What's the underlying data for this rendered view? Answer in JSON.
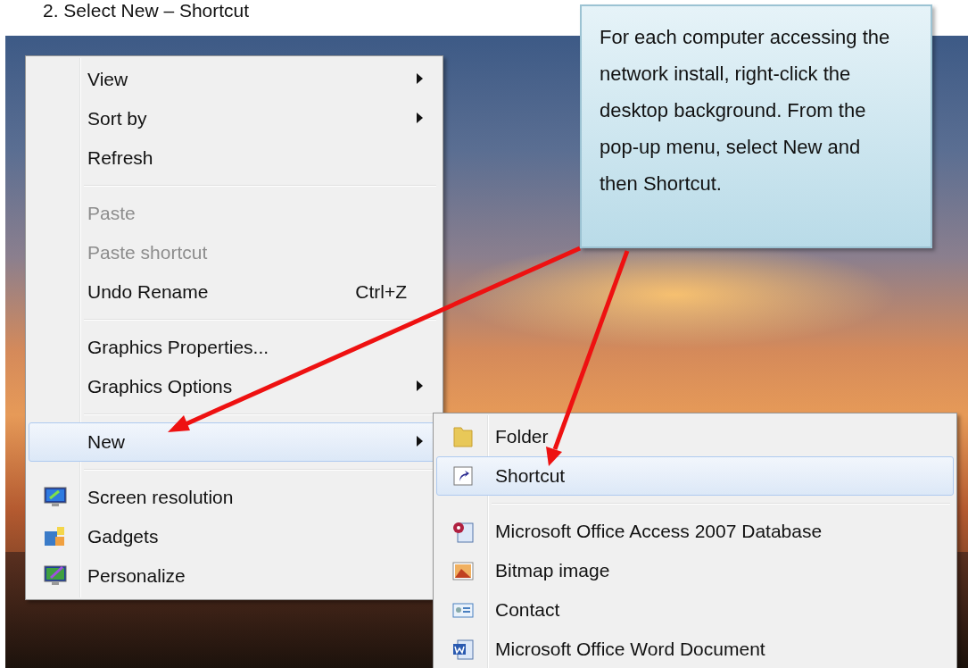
{
  "heading": "2.  Select New – Shortcut",
  "context_menu": {
    "groups": [
      {
        "items": [
          {
            "label": "View",
            "selected": false,
            "disabled": false,
            "submenu": true
          },
          {
            "label": "Sort by",
            "selected": false,
            "disabled": false,
            "submenu": true
          },
          {
            "label": "Refresh",
            "selected": false,
            "disabled": false,
            "submenu": false
          }
        ]
      },
      {
        "items": [
          {
            "label": "Paste",
            "selected": false,
            "disabled": true,
            "submenu": false
          },
          {
            "label": "Paste shortcut",
            "selected": false,
            "disabled": true,
            "submenu": false
          },
          {
            "label": "Undo Rename",
            "shortcut": "Ctrl+Z",
            "selected": false,
            "disabled": false,
            "submenu": false
          }
        ]
      },
      {
        "items": [
          {
            "label": "Graphics Properties...",
            "selected": false,
            "disabled": false,
            "submenu": false
          },
          {
            "label": "Graphics Options",
            "selected": false,
            "disabled": false,
            "submenu": true
          }
        ]
      },
      {
        "items": [
          {
            "label": "New",
            "selected": true,
            "disabled": false,
            "submenu": true
          }
        ]
      },
      {
        "items": [
          {
            "label": "Screen resolution",
            "selected": false,
            "disabled": false,
            "submenu": false
          },
          {
            "label": "Gadgets",
            "selected": false,
            "disabled": false,
            "submenu": false
          },
          {
            "label": "Personalize",
            "selected": false,
            "disabled": false,
            "submenu": false
          }
        ]
      }
    ]
  },
  "new_submenu": {
    "groups": [
      {
        "items": [
          {
            "label": "Folder",
            "selected": false,
            "disabled": false,
            "submenu": false
          },
          {
            "label": "Shortcut",
            "selected": true,
            "disabled": false,
            "submenu": false
          }
        ]
      },
      {
        "items": [
          {
            "label": "Microsoft Office Access 2007 Database",
            "selected": false,
            "disabled": false,
            "submenu": false
          },
          {
            "label": "Bitmap image",
            "selected": false,
            "disabled": false,
            "submenu": false
          },
          {
            "label": "Contact",
            "selected": false,
            "disabled": false,
            "submenu": false
          },
          {
            "label": "Microsoft Office Word Document",
            "selected": false,
            "disabled": false,
            "submenu": false
          }
        ]
      }
    ]
  },
  "callout": {
    "text": "For each computer accessing the network install, right-click the desktop background. From the pop-up menu, select New and then Shortcut."
  }
}
